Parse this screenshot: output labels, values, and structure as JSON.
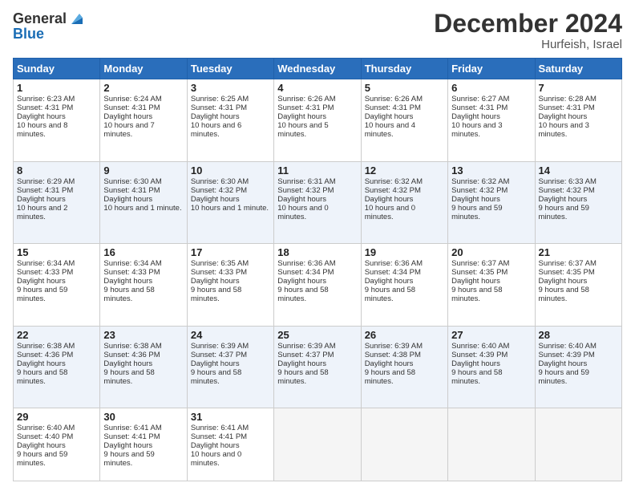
{
  "logo": {
    "line1": "General",
    "line2": "Blue"
  },
  "header": {
    "month": "December 2024",
    "location": "Hurfeish, Israel"
  },
  "days_of_week": [
    "Sunday",
    "Monday",
    "Tuesday",
    "Wednesday",
    "Thursday",
    "Friday",
    "Saturday"
  ],
  "weeks": [
    [
      {
        "day": 1,
        "sunrise": "6:23 AM",
        "sunset": "4:31 PM",
        "daylight": "10 hours and 8 minutes."
      },
      {
        "day": 2,
        "sunrise": "6:24 AM",
        "sunset": "4:31 PM",
        "daylight": "10 hours and 7 minutes."
      },
      {
        "day": 3,
        "sunrise": "6:25 AM",
        "sunset": "4:31 PM",
        "daylight": "10 hours and 6 minutes."
      },
      {
        "day": 4,
        "sunrise": "6:26 AM",
        "sunset": "4:31 PM",
        "daylight": "10 hours and 5 minutes."
      },
      {
        "day": 5,
        "sunrise": "6:26 AM",
        "sunset": "4:31 PM",
        "daylight": "10 hours and 4 minutes."
      },
      {
        "day": 6,
        "sunrise": "6:27 AM",
        "sunset": "4:31 PM",
        "daylight": "10 hours and 3 minutes."
      },
      {
        "day": 7,
        "sunrise": "6:28 AM",
        "sunset": "4:31 PM",
        "daylight": "10 hours and 3 minutes."
      }
    ],
    [
      {
        "day": 8,
        "sunrise": "6:29 AM",
        "sunset": "4:31 PM",
        "daylight": "10 hours and 2 minutes."
      },
      {
        "day": 9,
        "sunrise": "6:30 AM",
        "sunset": "4:31 PM",
        "daylight": "10 hours and 1 minute."
      },
      {
        "day": 10,
        "sunrise": "6:30 AM",
        "sunset": "4:32 PM",
        "daylight": "10 hours and 1 minute."
      },
      {
        "day": 11,
        "sunrise": "6:31 AM",
        "sunset": "4:32 PM",
        "daylight": "10 hours and 0 minutes."
      },
      {
        "day": 12,
        "sunrise": "6:32 AM",
        "sunset": "4:32 PM",
        "daylight": "10 hours and 0 minutes."
      },
      {
        "day": 13,
        "sunrise": "6:32 AM",
        "sunset": "4:32 PM",
        "daylight": "9 hours and 59 minutes."
      },
      {
        "day": 14,
        "sunrise": "6:33 AM",
        "sunset": "4:32 PM",
        "daylight": "9 hours and 59 minutes."
      }
    ],
    [
      {
        "day": 15,
        "sunrise": "6:34 AM",
        "sunset": "4:33 PM",
        "daylight": "9 hours and 59 minutes."
      },
      {
        "day": 16,
        "sunrise": "6:34 AM",
        "sunset": "4:33 PM",
        "daylight": "9 hours and 58 minutes."
      },
      {
        "day": 17,
        "sunrise": "6:35 AM",
        "sunset": "4:33 PM",
        "daylight": "9 hours and 58 minutes."
      },
      {
        "day": 18,
        "sunrise": "6:36 AM",
        "sunset": "4:34 PM",
        "daylight": "9 hours and 58 minutes."
      },
      {
        "day": 19,
        "sunrise": "6:36 AM",
        "sunset": "4:34 PM",
        "daylight": "9 hours and 58 minutes."
      },
      {
        "day": 20,
        "sunrise": "6:37 AM",
        "sunset": "4:35 PM",
        "daylight": "9 hours and 58 minutes."
      },
      {
        "day": 21,
        "sunrise": "6:37 AM",
        "sunset": "4:35 PM",
        "daylight": "9 hours and 58 minutes."
      }
    ],
    [
      {
        "day": 22,
        "sunrise": "6:38 AM",
        "sunset": "4:36 PM",
        "daylight": "9 hours and 58 minutes."
      },
      {
        "day": 23,
        "sunrise": "6:38 AM",
        "sunset": "4:36 PM",
        "daylight": "9 hours and 58 minutes."
      },
      {
        "day": 24,
        "sunrise": "6:39 AM",
        "sunset": "4:37 PM",
        "daylight": "9 hours and 58 minutes."
      },
      {
        "day": 25,
        "sunrise": "6:39 AM",
        "sunset": "4:37 PM",
        "daylight": "9 hours and 58 minutes."
      },
      {
        "day": 26,
        "sunrise": "6:39 AM",
        "sunset": "4:38 PM",
        "daylight": "9 hours and 58 minutes."
      },
      {
        "day": 27,
        "sunrise": "6:40 AM",
        "sunset": "4:39 PM",
        "daylight": "9 hours and 58 minutes."
      },
      {
        "day": 28,
        "sunrise": "6:40 AM",
        "sunset": "4:39 PM",
        "daylight": "9 hours and 59 minutes."
      }
    ],
    [
      {
        "day": 29,
        "sunrise": "6:40 AM",
        "sunset": "4:40 PM",
        "daylight": "9 hours and 59 minutes."
      },
      {
        "day": 30,
        "sunrise": "6:41 AM",
        "sunset": "4:41 PM",
        "daylight": "9 hours and 59 minutes."
      },
      {
        "day": 31,
        "sunrise": "6:41 AM",
        "sunset": "4:41 PM",
        "daylight": "10 hours and 0 minutes."
      },
      null,
      null,
      null,
      null
    ]
  ]
}
